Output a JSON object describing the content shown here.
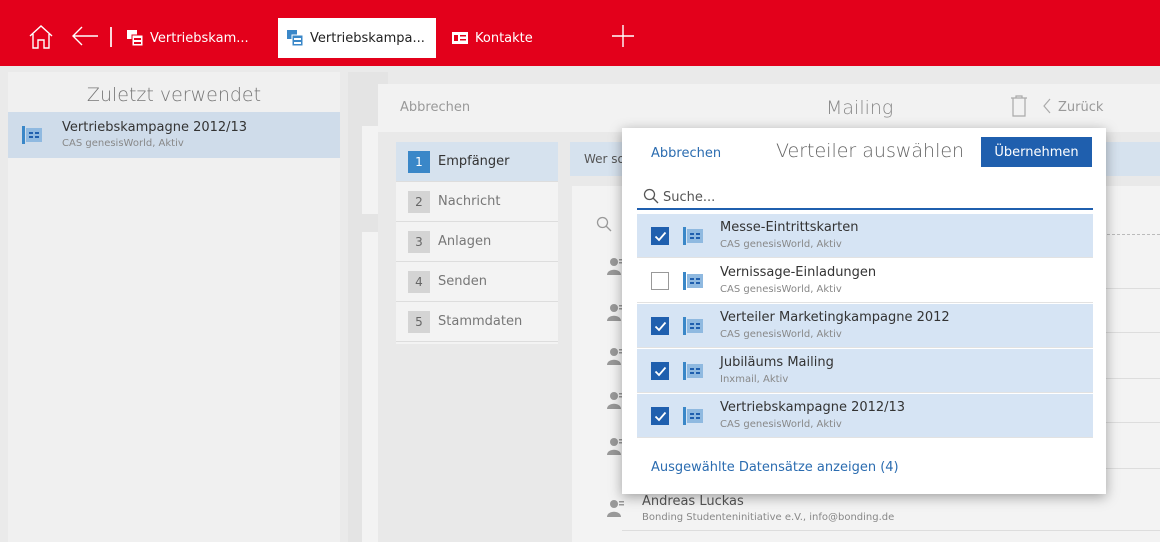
{
  "topbar": {
    "tabs": [
      {
        "label": "Vertriebskam...",
        "active": false
      },
      {
        "label": "Vertriebskampa...",
        "active": true
      },
      {
        "label": "Kontakte",
        "active": false
      }
    ],
    "accent": "#e3001b"
  },
  "recent": {
    "title": "Zuletzt verwendet",
    "items": [
      {
        "title": "Vertriebskampagne 2012/13",
        "subtitle": "CAS genesisWorld, Aktiv"
      }
    ]
  },
  "mailing": {
    "cancel_label": "Abbrechen",
    "title": "Mailing",
    "back_label": "Zurück",
    "steps": [
      {
        "num": "1",
        "label": "Empfänger",
        "active": true
      },
      {
        "num": "2",
        "label": "Nachricht",
        "active": false
      },
      {
        "num": "3",
        "label": "Anlagen",
        "active": false
      },
      {
        "num": "4",
        "label": "Senden",
        "active": false
      },
      {
        "num": "5",
        "label": "Stammdaten",
        "active": false
      }
    ],
    "who_label": "Wer so",
    "contact": {
      "name": "Andreas Luckas",
      "detail": "Bonding Studenteninitiative e.V., info@bonding.de"
    }
  },
  "popup": {
    "cancel_label": "Abbrechen",
    "title": "Verteiler auswählen",
    "apply_label": "Übernehmen",
    "search_placeholder": "Suche...",
    "items": [
      {
        "name": "Messe-Eintrittskarten",
        "sub": "CAS genesisWorld, Aktiv",
        "checked": true
      },
      {
        "name": "Vernissage-Einladungen",
        "sub": "CAS genesisWorld, Aktiv",
        "checked": false
      },
      {
        "name": "Verteiler Marketingkampagne 2012",
        "sub": "CAS genesisWorld, Aktiv",
        "checked": true
      },
      {
        "name": "Jubiläums Mailing",
        "sub": "Inxmail, Aktiv",
        "checked": true
      },
      {
        "name": "Vertriebskampagne 2012/13",
        "sub": "CAS genesisWorld, Aktiv",
        "checked": true
      }
    ],
    "footer_label": "Ausgewählte Datensätze anzeigen (4)",
    "accent": "#1f5fae"
  }
}
